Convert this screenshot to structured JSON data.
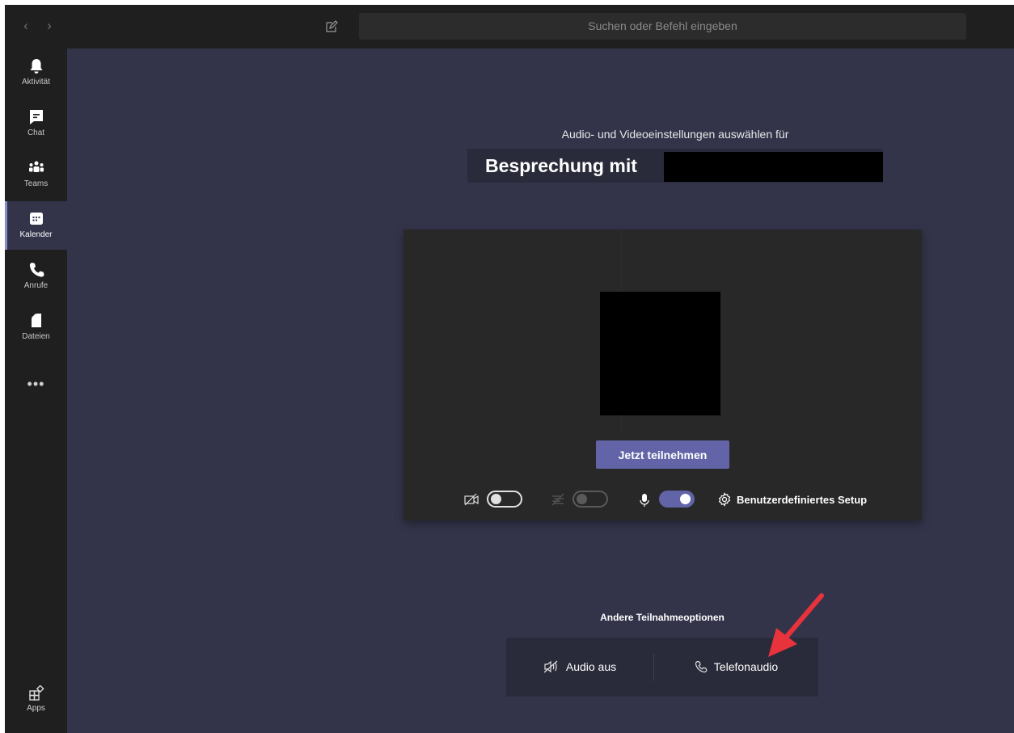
{
  "search": {
    "placeholder": "Suchen oder Befehl eingeben"
  },
  "rail": {
    "items": [
      {
        "label": "Aktivität",
        "icon": "bell-icon"
      },
      {
        "label": "Chat",
        "icon": "chat-icon"
      },
      {
        "label": "Teams",
        "icon": "teams-icon"
      },
      {
        "label": "Kalender",
        "icon": "calendar-icon",
        "active": true
      },
      {
        "label": "Anrufe",
        "icon": "phone-icon"
      },
      {
        "label": "Dateien",
        "icon": "file-icon"
      }
    ],
    "more": "•••",
    "apps": {
      "label": "Apps",
      "icon": "apps-icon"
    }
  },
  "prejoin": {
    "subtitle": "Audio- und Videoeinstellungen auswählen für",
    "meeting_title": "Besprechung mit",
    "join_label": "Jetzt teilnehmen",
    "custom_setup": "Benutzerdefiniertes Setup",
    "toggles": {
      "camera": "off",
      "blur": "off-disabled",
      "microphone": "on"
    }
  },
  "other_options": {
    "label": "Andere Teilnahmeoptionen",
    "audio_off": "Audio aus",
    "phone_audio": "Telefonaudio"
  },
  "colors": {
    "accent": "#6264a7",
    "background": "#33344a",
    "rail": "#201f1f",
    "annotation_arrow": "#e8323c"
  }
}
